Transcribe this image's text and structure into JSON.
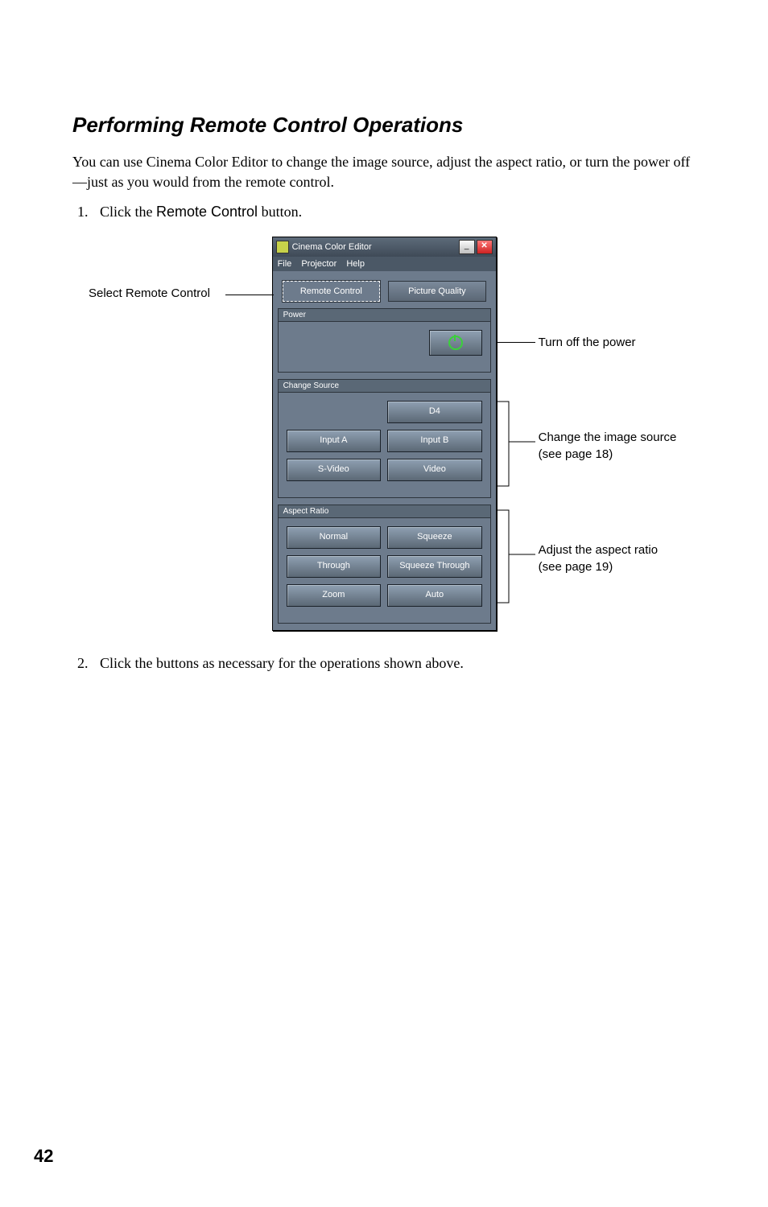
{
  "section_title": "Performing Remote Control Operations",
  "intro": "You can use Cinema Color Editor to change the image source, adjust the aspect ratio, or turn the power off—just as you would from the remote control.",
  "step1_pre": "Click the ",
  "step1_bold": "Remote Control",
  "step1_post": " button.",
  "step2": "Click the buttons as necessary for the operations shown above.",
  "left_annotation_pre": "Select ",
  "left_annotation_bold": "Remote Control",
  "window": {
    "title": "Cinema Color Editor",
    "menu": {
      "file": "File",
      "projector": "Projector",
      "help": "Help"
    },
    "tab_remote": "Remote Control",
    "tab_quality": "Picture Quality",
    "panel_power": "Power",
    "panel_source": "Change Source",
    "panel_aspect": "Aspect Ratio",
    "btn_d4": "D4",
    "btn_input_a": "Input A",
    "btn_input_b": "Input B",
    "btn_svideo": "S-Video",
    "btn_video": "Video",
    "btn_normal": "Normal",
    "btn_squeeze": "Squeeze",
    "btn_through": "Through",
    "btn_squeeze_through": "Squeeze Through",
    "btn_zoom": "Zoom",
    "btn_auto": "Auto"
  },
  "annot_power": "Turn off the power",
  "annot_source_l1": "Change the image source",
  "annot_source_l2": "(see page 18)",
  "annot_aspect_l1": "Adjust the aspect ratio",
  "annot_aspect_l2": "(see page 19)",
  "page_number": "42"
}
